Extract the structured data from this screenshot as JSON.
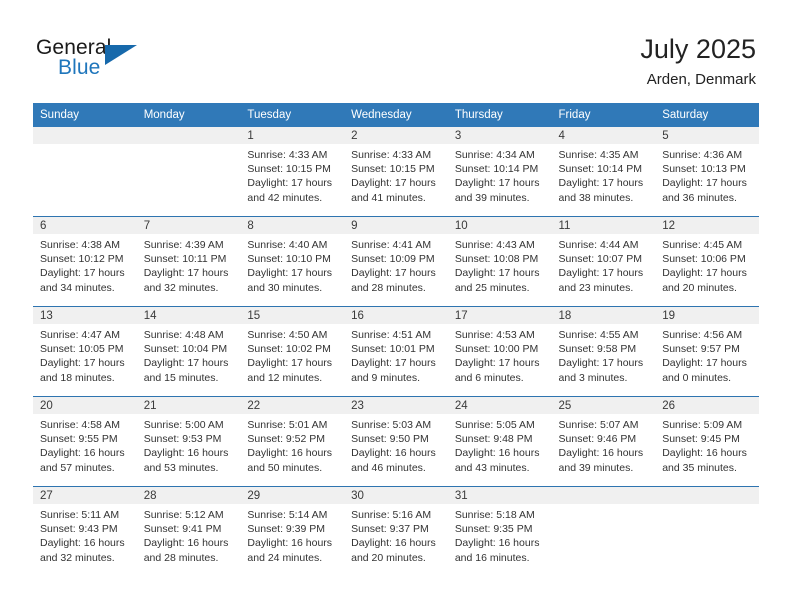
{
  "logo": {
    "word1": "General",
    "word2": "Blue",
    "triangle_color": "#1769ab",
    "blue_color": "#1f76bc"
  },
  "header": {
    "title": "July 2025",
    "location": "Arden, Denmark",
    "accent_color": "#3079b8"
  },
  "calendar": {
    "weekday_headers": [
      "Sunday",
      "Monday",
      "Tuesday",
      "Wednesday",
      "Thursday",
      "Friday",
      "Saturday"
    ],
    "weeks": [
      [
        {
          "day": "",
          "lines": []
        },
        {
          "day": "",
          "lines": []
        },
        {
          "day": "1",
          "lines": [
            "Sunrise: 4:33 AM",
            "Sunset: 10:15 PM",
            "Daylight: 17 hours",
            "and 42 minutes."
          ]
        },
        {
          "day": "2",
          "lines": [
            "Sunrise: 4:33 AM",
            "Sunset: 10:15 PM",
            "Daylight: 17 hours",
            "and 41 minutes."
          ]
        },
        {
          "day": "3",
          "lines": [
            "Sunrise: 4:34 AM",
            "Sunset: 10:14 PM",
            "Daylight: 17 hours",
            "and 39 minutes."
          ]
        },
        {
          "day": "4",
          "lines": [
            "Sunrise: 4:35 AM",
            "Sunset: 10:14 PM",
            "Daylight: 17 hours",
            "and 38 minutes."
          ]
        },
        {
          "day": "5",
          "lines": [
            "Sunrise: 4:36 AM",
            "Sunset: 10:13 PM",
            "Daylight: 17 hours",
            "and 36 minutes."
          ]
        }
      ],
      [
        {
          "day": "6",
          "lines": [
            "Sunrise: 4:38 AM",
            "Sunset: 10:12 PM",
            "Daylight: 17 hours",
            "and 34 minutes."
          ]
        },
        {
          "day": "7",
          "lines": [
            "Sunrise: 4:39 AM",
            "Sunset: 10:11 PM",
            "Daylight: 17 hours",
            "and 32 minutes."
          ]
        },
        {
          "day": "8",
          "lines": [
            "Sunrise: 4:40 AM",
            "Sunset: 10:10 PM",
            "Daylight: 17 hours",
            "and 30 minutes."
          ]
        },
        {
          "day": "9",
          "lines": [
            "Sunrise: 4:41 AM",
            "Sunset: 10:09 PM",
            "Daylight: 17 hours",
            "and 28 minutes."
          ]
        },
        {
          "day": "10",
          "lines": [
            "Sunrise: 4:43 AM",
            "Sunset: 10:08 PM",
            "Daylight: 17 hours",
            "and 25 minutes."
          ]
        },
        {
          "day": "11",
          "lines": [
            "Sunrise: 4:44 AM",
            "Sunset: 10:07 PM",
            "Daylight: 17 hours",
            "and 23 minutes."
          ]
        },
        {
          "day": "12",
          "lines": [
            "Sunrise: 4:45 AM",
            "Sunset: 10:06 PM",
            "Daylight: 17 hours",
            "and 20 minutes."
          ]
        }
      ],
      [
        {
          "day": "13",
          "lines": [
            "Sunrise: 4:47 AM",
            "Sunset: 10:05 PM",
            "Daylight: 17 hours",
            "and 18 minutes."
          ]
        },
        {
          "day": "14",
          "lines": [
            "Sunrise: 4:48 AM",
            "Sunset: 10:04 PM",
            "Daylight: 17 hours",
            "and 15 minutes."
          ]
        },
        {
          "day": "15",
          "lines": [
            "Sunrise: 4:50 AM",
            "Sunset: 10:02 PM",
            "Daylight: 17 hours",
            "and 12 minutes."
          ]
        },
        {
          "day": "16",
          "lines": [
            "Sunrise: 4:51 AM",
            "Sunset: 10:01 PM",
            "Daylight: 17 hours",
            "and 9 minutes."
          ]
        },
        {
          "day": "17",
          "lines": [
            "Sunrise: 4:53 AM",
            "Sunset: 10:00 PM",
            "Daylight: 17 hours",
            "and 6 minutes."
          ]
        },
        {
          "day": "18",
          "lines": [
            "Sunrise: 4:55 AM",
            "Sunset: 9:58 PM",
            "Daylight: 17 hours",
            "and 3 minutes."
          ]
        },
        {
          "day": "19",
          "lines": [
            "Sunrise: 4:56 AM",
            "Sunset: 9:57 PM",
            "Daylight: 17 hours",
            "and 0 minutes."
          ]
        }
      ],
      [
        {
          "day": "20",
          "lines": [
            "Sunrise: 4:58 AM",
            "Sunset: 9:55 PM",
            "Daylight: 16 hours",
            "and 57 minutes."
          ]
        },
        {
          "day": "21",
          "lines": [
            "Sunrise: 5:00 AM",
            "Sunset: 9:53 PM",
            "Daylight: 16 hours",
            "and 53 minutes."
          ]
        },
        {
          "day": "22",
          "lines": [
            "Sunrise: 5:01 AM",
            "Sunset: 9:52 PM",
            "Daylight: 16 hours",
            "and 50 minutes."
          ]
        },
        {
          "day": "23",
          "lines": [
            "Sunrise: 5:03 AM",
            "Sunset: 9:50 PM",
            "Daylight: 16 hours",
            "and 46 minutes."
          ]
        },
        {
          "day": "24",
          "lines": [
            "Sunrise: 5:05 AM",
            "Sunset: 9:48 PM",
            "Daylight: 16 hours",
            "and 43 minutes."
          ]
        },
        {
          "day": "25",
          "lines": [
            "Sunrise: 5:07 AM",
            "Sunset: 9:46 PM",
            "Daylight: 16 hours",
            "and 39 minutes."
          ]
        },
        {
          "day": "26",
          "lines": [
            "Sunrise: 5:09 AM",
            "Sunset: 9:45 PM",
            "Daylight: 16 hours",
            "and 35 minutes."
          ]
        }
      ],
      [
        {
          "day": "27",
          "lines": [
            "Sunrise: 5:11 AM",
            "Sunset: 9:43 PM",
            "Daylight: 16 hours",
            "and 32 minutes."
          ]
        },
        {
          "day": "28",
          "lines": [
            "Sunrise: 5:12 AM",
            "Sunset: 9:41 PM",
            "Daylight: 16 hours",
            "and 28 minutes."
          ]
        },
        {
          "day": "29",
          "lines": [
            "Sunrise: 5:14 AM",
            "Sunset: 9:39 PM",
            "Daylight: 16 hours",
            "and 24 minutes."
          ]
        },
        {
          "day": "30",
          "lines": [
            "Sunrise: 5:16 AM",
            "Sunset: 9:37 PM",
            "Daylight: 16 hours",
            "and 20 minutes."
          ]
        },
        {
          "day": "31",
          "lines": [
            "Sunrise: 5:18 AM",
            "Sunset: 9:35 PM",
            "Daylight: 16 hours",
            "and 16 minutes."
          ]
        },
        {
          "day": "",
          "lines": []
        },
        {
          "day": "",
          "lines": []
        }
      ]
    ]
  }
}
